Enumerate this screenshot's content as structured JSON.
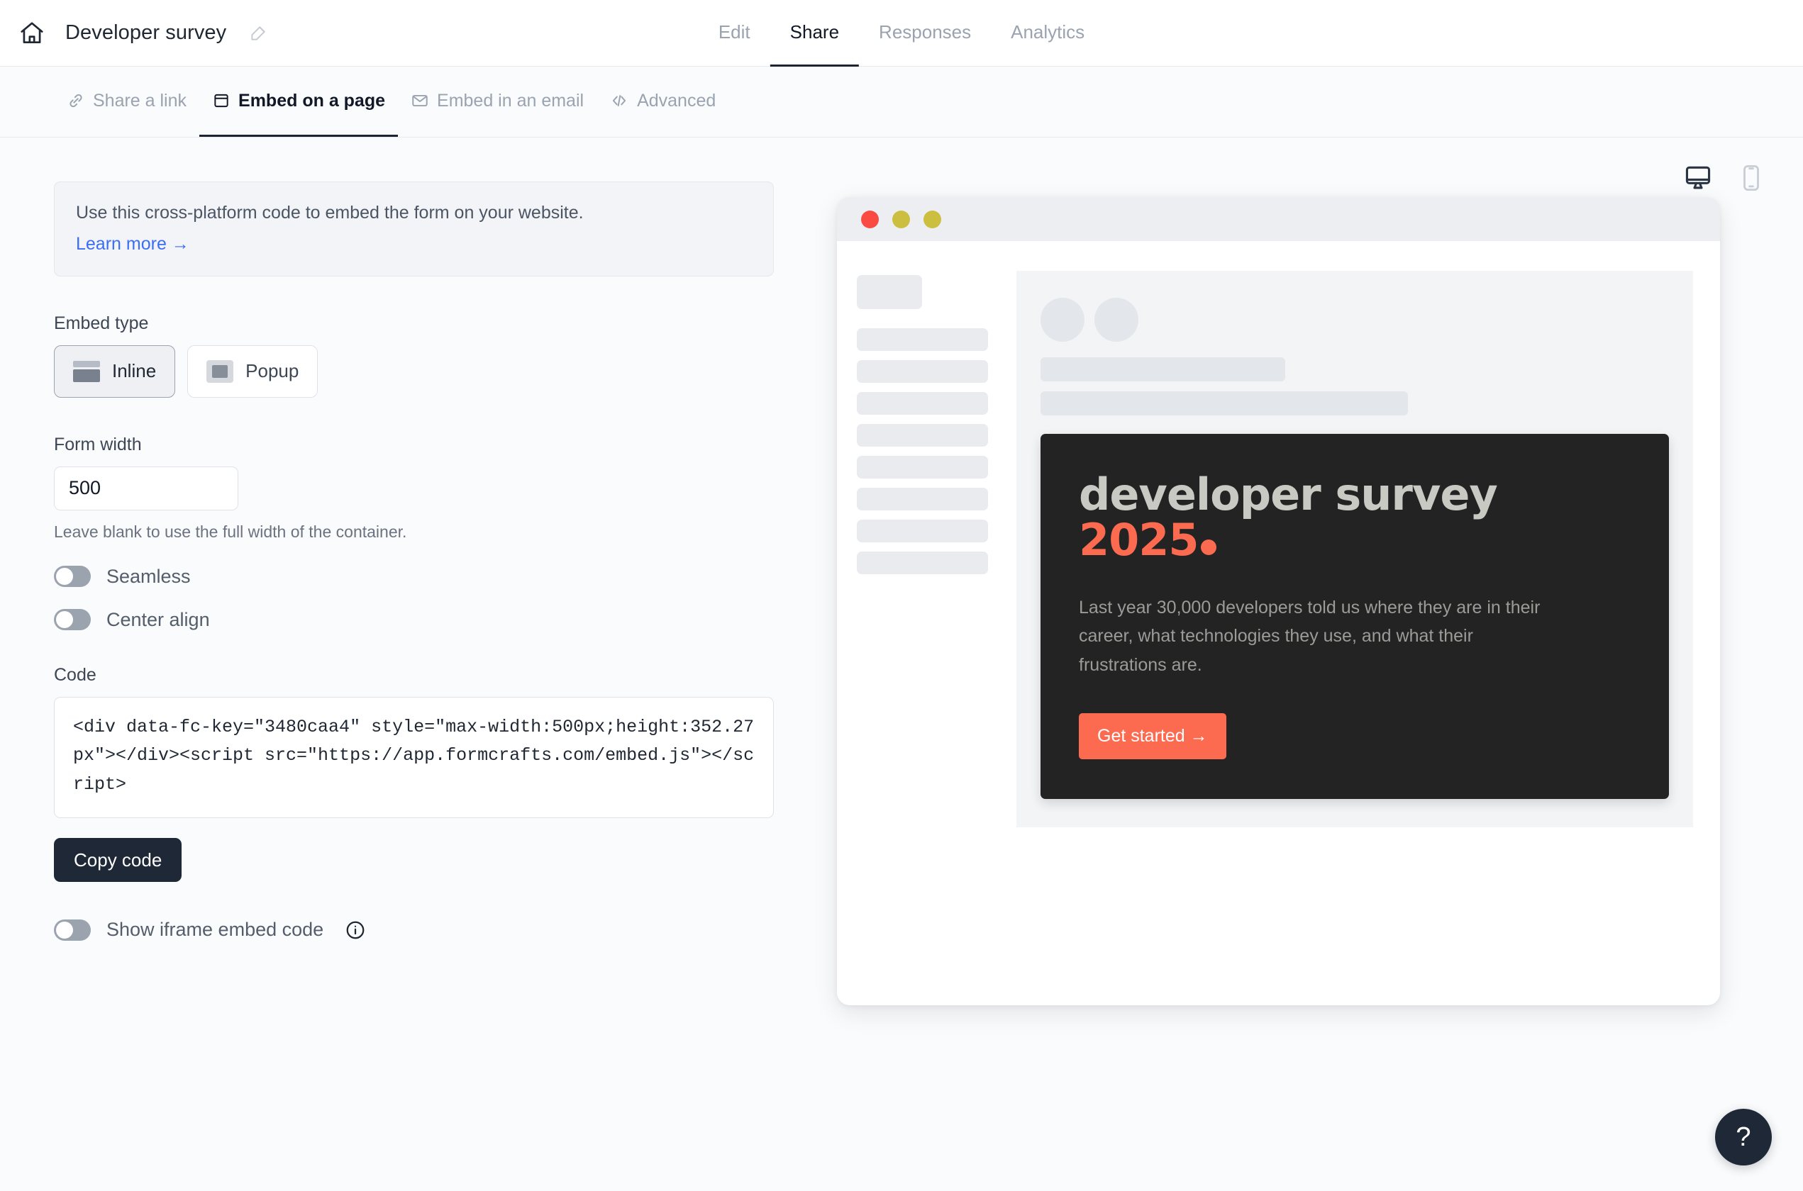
{
  "header": {
    "home_icon": "home-icon",
    "form_title": "Developer survey",
    "edit_icon": "pencil-edit-icon",
    "tabs": [
      {
        "label": "Edit",
        "active": false
      },
      {
        "label": "Share",
        "active": true
      },
      {
        "label": "Responses",
        "active": false
      },
      {
        "label": "Analytics",
        "active": false
      }
    ]
  },
  "subtabs": [
    {
      "label": "Share a link",
      "icon": "link-icon",
      "active": false
    },
    {
      "label": "Embed on a page",
      "icon": "window-icon",
      "active": true
    },
    {
      "label": "Embed in an email",
      "icon": "envelope-icon",
      "active": false
    },
    {
      "label": "Advanced",
      "icon": "code-icon",
      "active": false
    }
  ],
  "banner": {
    "text": "Use this cross-platform code to embed the form on your website.",
    "link_label": "Learn more →"
  },
  "embed_type": {
    "label": "Embed type",
    "options": [
      {
        "label": "Inline",
        "icon": "inline-layout-icon",
        "selected": true
      },
      {
        "label": "Popup",
        "icon": "popup-layout-icon",
        "selected": false
      }
    ]
  },
  "form_width": {
    "label": "Form width",
    "value": "500",
    "placeholder": "",
    "help": "Leave blank to use the full width of the container."
  },
  "toggles": [
    {
      "label": "Seamless",
      "on": false
    },
    {
      "label": "Center align",
      "on": false
    }
  ],
  "code_section": {
    "label": "Code",
    "value": "<div data-fc-key=\"3480caa4\" style=\"max-width:500px;height:352.27px\"></div><script src=\"https://app.formcrafts.com/embed.js\"></scr",
    "value_tail": "ipt>",
    "copy_label": "Copy code"
  },
  "iframe_toggle": {
    "label": "Show iframe embed code",
    "on": false,
    "info_icon": "info-circle-icon"
  },
  "preview": {
    "device_buttons": [
      {
        "name": "desktop-icon",
        "active": true
      },
      {
        "name": "mobile-icon",
        "active": false
      }
    ],
    "window_dots": [
      "#fb4a42",
      "#ccbe3e",
      "#ccbe3e"
    ],
    "skeleton": {
      "head_blocks": 1,
      "bar_blocks": 8
    },
    "panel_skeleton": {
      "circles": 2,
      "bars": [
        "short",
        "long"
      ]
    },
    "survey": {
      "title_line1": "developer survey",
      "title_line2": "2025",
      "description": "Last year 30,000 developers told us where they are in their career, what technologies they use, and what their frustrations are.",
      "cta_label": "Get started →",
      "accent_color": "#fc6a50",
      "card_bg": "#232323"
    }
  },
  "help_fab": {
    "label": "?"
  }
}
